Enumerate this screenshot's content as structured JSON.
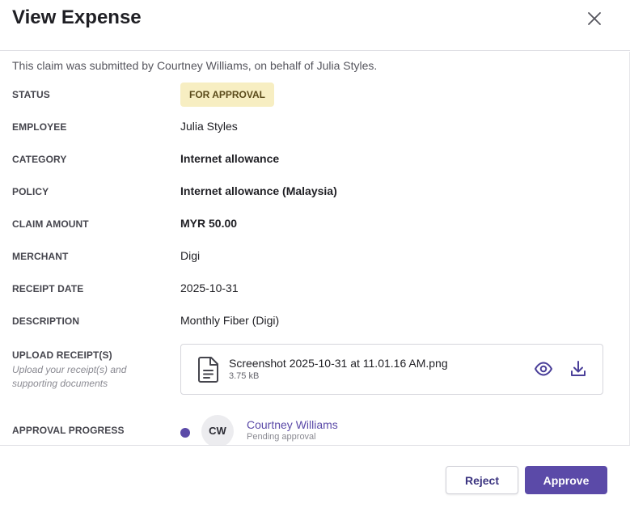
{
  "modal": {
    "title": "View Expense"
  },
  "notice": "This claim was submitted by Courtney Williams, on behalf of Julia Styles.",
  "fields": {
    "status": {
      "label": "STATUS",
      "value": "FOR APPROVAL"
    },
    "employee": {
      "label": "EMPLOYEE",
      "value": "Julia Styles"
    },
    "category": {
      "label": "CATEGORY",
      "value": "Internet allowance"
    },
    "policy": {
      "label": "POLICY",
      "value": "Internet allowance (Malaysia)"
    },
    "claim_amount": {
      "label": "CLAIM AMOUNT",
      "value": "MYR 50.00"
    },
    "merchant": {
      "label": "MERCHANT",
      "value": "Digi"
    },
    "receipt_date": {
      "label": "RECEIPT DATE",
      "value": "2025-10-31"
    },
    "description": {
      "label": "DESCRIPTION",
      "value": "Monthly Fiber (Digi)"
    },
    "upload_receipts": {
      "label": "UPLOAD RECEIPT(S)",
      "hint": "Upload your receipt(s) and supporting documents"
    },
    "approval_progress": {
      "label": "APPROVAL PROGRESS"
    }
  },
  "attachment": {
    "file_name": "Screenshot 2025-10-31 at 11.01.16 AM.png",
    "file_size": "3.75 kB",
    "icon": "document-icon"
  },
  "approver": {
    "initials": "CW",
    "name": "Courtney Williams",
    "status": "Pending approval"
  },
  "footer": {
    "reject_label": "Reject",
    "approve_label": "Approve"
  },
  "colors": {
    "accent": "#5b4aa8",
    "status_badge_bg": "#f7eec2",
    "status_badge_text": "#5a4a1a"
  }
}
